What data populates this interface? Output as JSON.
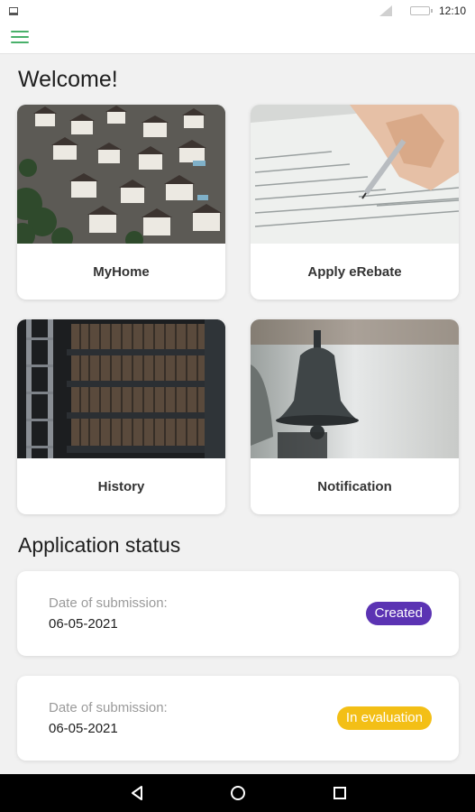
{
  "status_bar": {
    "time": "12:10"
  },
  "header": {
    "title": "Welcome!",
    "menu_icon": "menu-icon",
    "accent": "#49b06a"
  },
  "tiles": [
    {
      "label": "MyHome",
      "image": "houses-aerial-photo"
    },
    {
      "label": "Apply eRebate",
      "image": "hand-writing-form-photo"
    },
    {
      "label": "History",
      "image": "bookshelf-photo"
    },
    {
      "label": "Notification",
      "image": "bell-photo"
    }
  ],
  "application_status": {
    "title": "Application status",
    "items": [
      {
        "caption": "Date of submission:",
        "date": "06-05-2021",
        "status": "Created",
        "status_color": "#5b33b3"
      },
      {
        "caption": "Date of submission:",
        "date": "06-05-2021",
        "status": "In evaluation",
        "status_color": "#f3bf16"
      }
    ]
  },
  "nav_bar": {
    "icons": [
      "back-icon",
      "home-icon",
      "recent-apps-icon"
    ]
  }
}
